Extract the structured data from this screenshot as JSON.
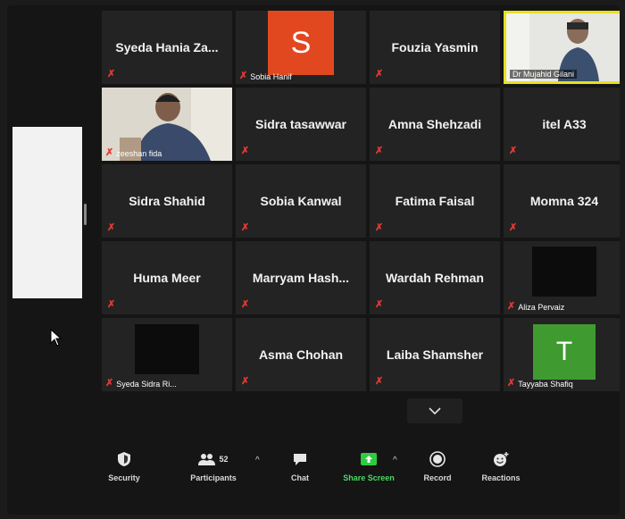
{
  "participants": [
    {
      "name": "Syeda  Hania  Za...",
      "type": "name",
      "label": "",
      "muted": true
    },
    {
      "name": "",
      "type": "avatar",
      "avatar_letter": "S",
      "avatar_color": "#e2481f",
      "label": "Sobia Hanif",
      "muted": true
    },
    {
      "name": "Fouzia Yasmin",
      "type": "name",
      "label": "",
      "muted": true
    },
    {
      "name": "",
      "type": "video",
      "label": "Dr Mujahid Gilani",
      "muted": false,
      "active_speaker": true
    },
    {
      "name": "",
      "type": "video",
      "label": "zeeshan fida",
      "muted": true
    },
    {
      "name": "Sidra tasawwar",
      "type": "name",
      "label": "",
      "muted": true
    },
    {
      "name": "Amna Shehzadi",
      "type": "name",
      "label": "",
      "muted": true
    },
    {
      "name": "itel A33",
      "type": "name",
      "label": "",
      "muted": true
    },
    {
      "name": "Sidra Shahid",
      "type": "name",
      "label": "",
      "muted": true
    },
    {
      "name": "Sobia Kanwal",
      "type": "name",
      "label": "",
      "muted": true
    },
    {
      "name": "Fatima Faisal",
      "type": "name",
      "label": "",
      "muted": true
    },
    {
      "name": "Momna 324",
      "type": "name",
      "label": "",
      "muted": true
    },
    {
      "name": "Huma Meer",
      "type": "name",
      "label": "",
      "muted": true
    },
    {
      "name": "Marryam  Hash...",
      "type": "name",
      "label": "",
      "muted": true
    },
    {
      "name": "Wardah Rehman",
      "type": "name",
      "label": "",
      "muted": true
    },
    {
      "name": "",
      "type": "blank",
      "label": "Aliza Pervaiz",
      "muted": true
    },
    {
      "name": "",
      "type": "blank",
      "label": "Syeda Sidra Ri...",
      "muted": true
    },
    {
      "name": "Asma Chohan",
      "type": "name",
      "label": "",
      "muted": true
    },
    {
      "name": "Laiba Shamsher",
      "type": "name",
      "label": "",
      "muted": true
    },
    {
      "name": "",
      "type": "avatar",
      "avatar_letter": "T",
      "avatar_color": "#3f9b30",
      "label": "Tayyaba Shafiq",
      "muted": true
    }
  ],
  "toolbar": {
    "security_label": "Security",
    "participants_label": "Participants",
    "participants_count": "52",
    "chat_label": "Chat",
    "share_label": "Share Screen",
    "record_label": "Record",
    "reactions_label": "Reactions"
  },
  "icons": {
    "security": "shield-icon",
    "participants": "people-icon",
    "chat": "chat-bubble-icon",
    "share": "share-screen-icon",
    "record": "record-icon",
    "reactions": "emoji-add-icon",
    "scroll": "chevron-down-icon",
    "mic": "mic-muted-icon"
  },
  "colors": {
    "active_speaker_border": "#e7e01f",
    "share_green": "#4cd964",
    "muted_red": "#e53935"
  }
}
